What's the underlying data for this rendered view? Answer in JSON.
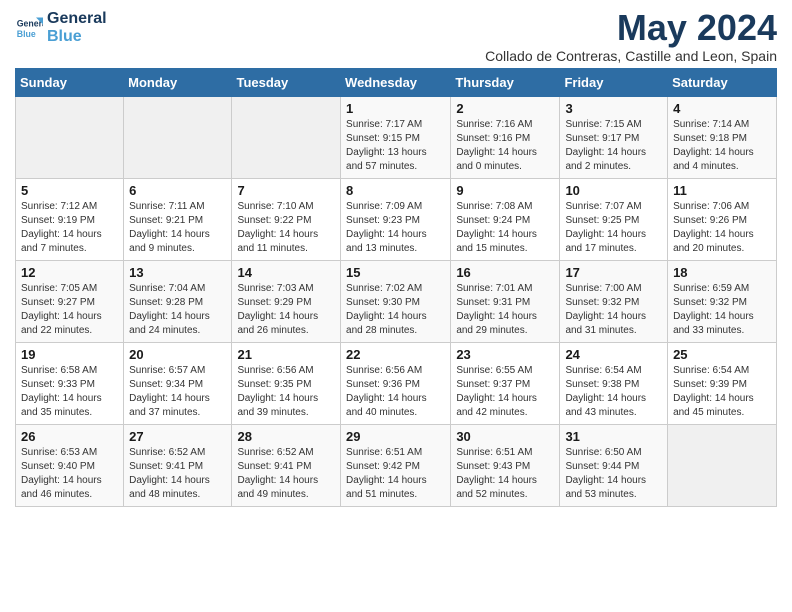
{
  "header": {
    "logo_line1": "General",
    "logo_line2": "Blue",
    "month": "May 2024",
    "location": "Collado de Contreras, Castille and Leon, Spain"
  },
  "weekdays": [
    "Sunday",
    "Monday",
    "Tuesday",
    "Wednesday",
    "Thursday",
    "Friday",
    "Saturday"
  ],
  "weeks": [
    [
      {
        "day": "",
        "info": ""
      },
      {
        "day": "",
        "info": ""
      },
      {
        "day": "",
        "info": ""
      },
      {
        "day": "1",
        "info": "Sunrise: 7:17 AM\nSunset: 9:15 PM\nDaylight: 13 hours and 57 minutes."
      },
      {
        "day": "2",
        "info": "Sunrise: 7:16 AM\nSunset: 9:16 PM\nDaylight: 14 hours and 0 minutes."
      },
      {
        "day": "3",
        "info": "Sunrise: 7:15 AM\nSunset: 9:17 PM\nDaylight: 14 hours and 2 minutes."
      },
      {
        "day": "4",
        "info": "Sunrise: 7:14 AM\nSunset: 9:18 PM\nDaylight: 14 hours and 4 minutes."
      }
    ],
    [
      {
        "day": "5",
        "info": "Sunrise: 7:12 AM\nSunset: 9:19 PM\nDaylight: 14 hours and 7 minutes."
      },
      {
        "day": "6",
        "info": "Sunrise: 7:11 AM\nSunset: 9:21 PM\nDaylight: 14 hours and 9 minutes."
      },
      {
        "day": "7",
        "info": "Sunrise: 7:10 AM\nSunset: 9:22 PM\nDaylight: 14 hours and 11 minutes."
      },
      {
        "day": "8",
        "info": "Sunrise: 7:09 AM\nSunset: 9:23 PM\nDaylight: 14 hours and 13 minutes."
      },
      {
        "day": "9",
        "info": "Sunrise: 7:08 AM\nSunset: 9:24 PM\nDaylight: 14 hours and 15 minutes."
      },
      {
        "day": "10",
        "info": "Sunrise: 7:07 AM\nSunset: 9:25 PM\nDaylight: 14 hours and 17 minutes."
      },
      {
        "day": "11",
        "info": "Sunrise: 7:06 AM\nSunset: 9:26 PM\nDaylight: 14 hours and 20 minutes."
      }
    ],
    [
      {
        "day": "12",
        "info": "Sunrise: 7:05 AM\nSunset: 9:27 PM\nDaylight: 14 hours and 22 minutes."
      },
      {
        "day": "13",
        "info": "Sunrise: 7:04 AM\nSunset: 9:28 PM\nDaylight: 14 hours and 24 minutes."
      },
      {
        "day": "14",
        "info": "Sunrise: 7:03 AM\nSunset: 9:29 PM\nDaylight: 14 hours and 26 minutes."
      },
      {
        "day": "15",
        "info": "Sunrise: 7:02 AM\nSunset: 9:30 PM\nDaylight: 14 hours and 28 minutes."
      },
      {
        "day": "16",
        "info": "Sunrise: 7:01 AM\nSunset: 9:31 PM\nDaylight: 14 hours and 29 minutes."
      },
      {
        "day": "17",
        "info": "Sunrise: 7:00 AM\nSunset: 9:32 PM\nDaylight: 14 hours and 31 minutes."
      },
      {
        "day": "18",
        "info": "Sunrise: 6:59 AM\nSunset: 9:32 PM\nDaylight: 14 hours and 33 minutes."
      }
    ],
    [
      {
        "day": "19",
        "info": "Sunrise: 6:58 AM\nSunset: 9:33 PM\nDaylight: 14 hours and 35 minutes."
      },
      {
        "day": "20",
        "info": "Sunrise: 6:57 AM\nSunset: 9:34 PM\nDaylight: 14 hours and 37 minutes."
      },
      {
        "day": "21",
        "info": "Sunrise: 6:56 AM\nSunset: 9:35 PM\nDaylight: 14 hours and 39 minutes."
      },
      {
        "day": "22",
        "info": "Sunrise: 6:56 AM\nSunset: 9:36 PM\nDaylight: 14 hours and 40 minutes."
      },
      {
        "day": "23",
        "info": "Sunrise: 6:55 AM\nSunset: 9:37 PM\nDaylight: 14 hours and 42 minutes."
      },
      {
        "day": "24",
        "info": "Sunrise: 6:54 AM\nSunset: 9:38 PM\nDaylight: 14 hours and 43 minutes."
      },
      {
        "day": "25",
        "info": "Sunrise: 6:54 AM\nSunset: 9:39 PM\nDaylight: 14 hours and 45 minutes."
      }
    ],
    [
      {
        "day": "26",
        "info": "Sunrise: 6:53 AM\nSunset: 9:40 PM\nDaylight: 14 hours and 46 minutes."
      },
      {
        "day": "27",
        "info": "Sunrise: 6:52 AM\nSunset: 9:41 PM\nDaylight: 14 hours and 48 minutes."
      },
      {
        "day": "28",
        "info": "Sunrise: 6:52 AM\nSunset: 9:41 PM\nDaylight: 14 hours and 49 minutes."
      },
      {
        "day": "29",
        "info": "Sunrise: 6:51 AM\nSunset: 9:42 PM\nDaylight: 14 hours and 51 minutes."
      },
      {
        "day": "30",
        "info": "Sunrise: 6:51 AM\nSunset: 9:43 PM\nDaylight: 14 hours and 52 minutes."
      },
      {
        "day": "31",
        "info": "Sunrise: 6:50 AM\nSunset: 9:44 PM\nDaylight: 14 hours and 53 minutes."
      },
      {
        "day": "",
        "info": ""
      }
    ]
  ]
}
